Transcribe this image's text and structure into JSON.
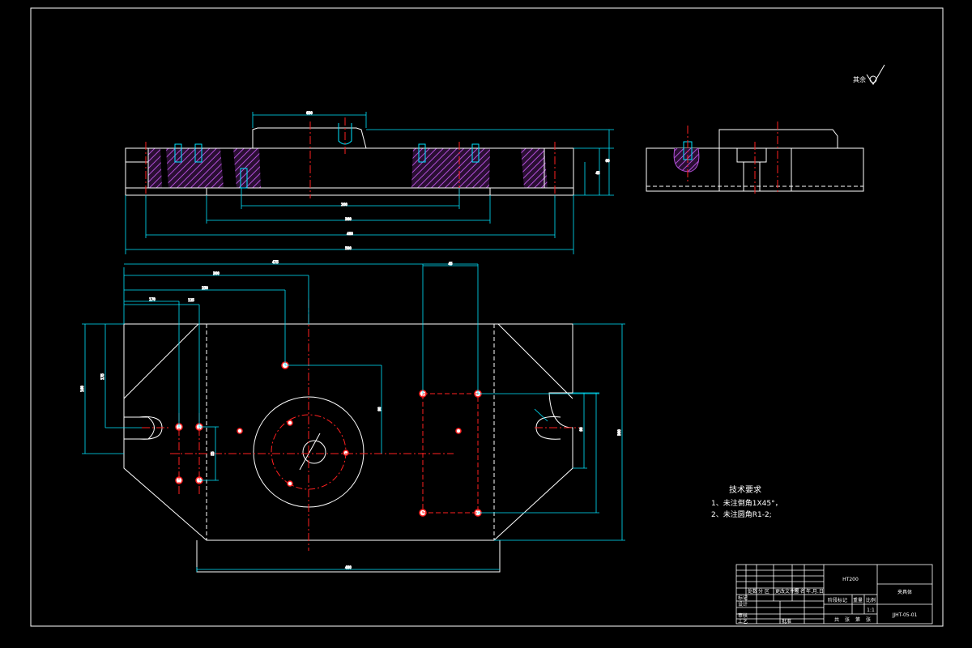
{
  "colors": {
    "background": "#000000",
    "outline": "#ffffff",
    "dimension": "#00e5ff",
    "centerline": "#ff2020",
    "hatch": "#b04fd6"
  },
  "roughness": {
    "label": "其余"
  },
  "tech_requirements": {
    "title": "技术要求",
    "items": [
      "1、未注倒角1X45°，",
      "2、未注圆角R1-2;"
    ]
  },
  "title_block": {
    "material": "HT200",
    "part_name": "夹具体",
    "drawing_number": "JJHT-05-01",
    "scale": "1:1",
    "row_labels": [
      "标记",
      "设计",
      "审核",
      "工艺"
    ],
    "column_labels": [
      "处数",
      "分 区",
      "更改文件号",
      "签 名",
      "年.月.日"
    ],
    "stage_label": "阶段标记",
    "weight_label": "重量",
    "scale_label": "比例",
    "sheet_labels": [
      "共",
      "张",
      "第",
      "张"
    ],
    "approve_label": "批准"
  },
  "dimensions": {
    "front_view": [
      "200",
      "380",
      "480",
      "590",
      "630",
      "60",
      "45"
    ],
    "plan_view": [
      "475",
      "300",
      "250",
      "170",
      "125",
      "160",
      "175",
      "90",
      "55",
      "45",
      "90",
      "300",
      "480"
    ]
  }
}
